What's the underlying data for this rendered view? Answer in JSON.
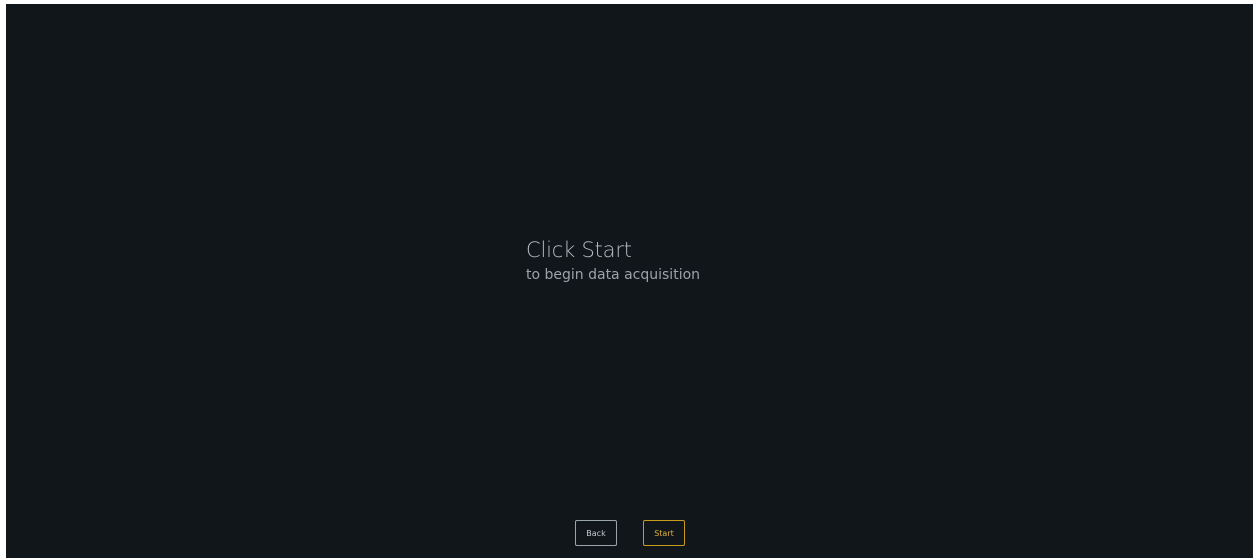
{
  "prompt": {
    "title": "Click Start",
    "subtitle": "to begin data acquisition"
  },
  "actions": {
    "back_label": "Back",
    "start_label": "Start"
  },
  "colors": {
    "background": "#11161a",
    "accent": "#c79a1e",
    "text": "#b4bdc3"
  }
}
